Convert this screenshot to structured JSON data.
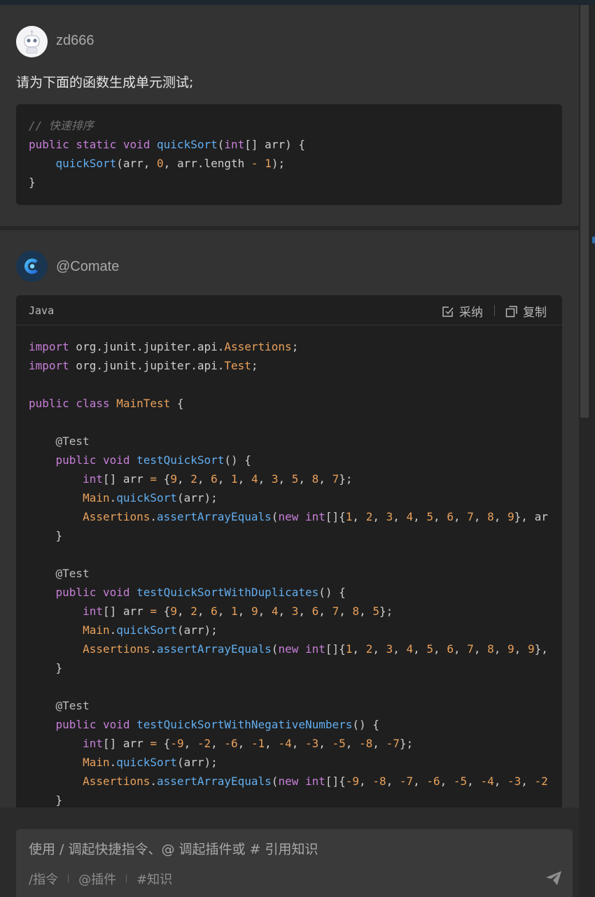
{
  "user_message": {
    "username": "zd666",
    "prompt": "请为下面的函数生成单元测试;",
    "code_lines": [
      "// 快速排序",
      "public static void quickSort(int[] arr) {",
      "    quickSort(arr, 0, arr.length - 1);",
      "}"
    ]
  },
  "bot_message": {
    "name": "@Comate",
    "code_block": {
      "language": "Java",
      "accept_label": "采纳",
      "copy_label": "复制"
    },
    "code_lines": [
      "import org.junit.jupiter.api.Assertions;",
      "import org.junit.jupiter.api.Test;",
      "",
      "public class MainTest {",
      "",
      "    @Test",
      "    public void testQuickSort() {",
      "        int[] arr = {9, 2, 6, 1, 4, 3, 5, 8, 7};",
      "        Main.quickSort(arr);",
      "        Assertions.assertArrayEquals(new int[]{1, 2, 3, 4, 5, 6, 7, 8, 9}, ar",
      "    }",
      "",
      "    @Test",
      "    public void testQuickSortWithDuplicates() {",
      "        int[] arr = {9, 2, 6, 1, 9, 4, 3, 6, 7, 8, 5};",
      "        Main.quickSort(arr);",
      "        Assertions.assertArrayEquals(new int[]{1, 2, 3, 4, 5, 6, 7, 8, 9, 9},",
      "    }",
      "",
      "    @Test",
      "    public void testQuickSortWithNegativeNumbers() {",
      "        int[] arr = {-9, -2, -6, -1, -4, -3, -5, -8, -7};",
      "        Main.quickSort(arr);",
      "        Assertions.assertArrayEquals(new int[]{-9, -8, -7, -6, -5, -4, -3, -2",
      "    }"
    ]
  },
  "input": {
    "placeholder": "使用 / 调起快捷指令、@ 调起插件或 # 引用知识",
    "shortcuts": [
      "/指令",
      "@插件",
      "#知识"
    ]
  },
  "colors": {
    "keyword": "#c77fd8",
    "function": "#62aef0",
    "class": "#e9a15c",
    "number": "#e9a15c",
    "comment": "#727272",
    "accent": "#2f6fb3"
  },
  "icons": {
    "accept": "checkbox-edit-icon",
    "copy": "copy-icon",
    "send": "send-icon",
    "bot_avatar": "comate-logo-icon",
    "user_avatar": "robot-avatar-icon"
  }
}
